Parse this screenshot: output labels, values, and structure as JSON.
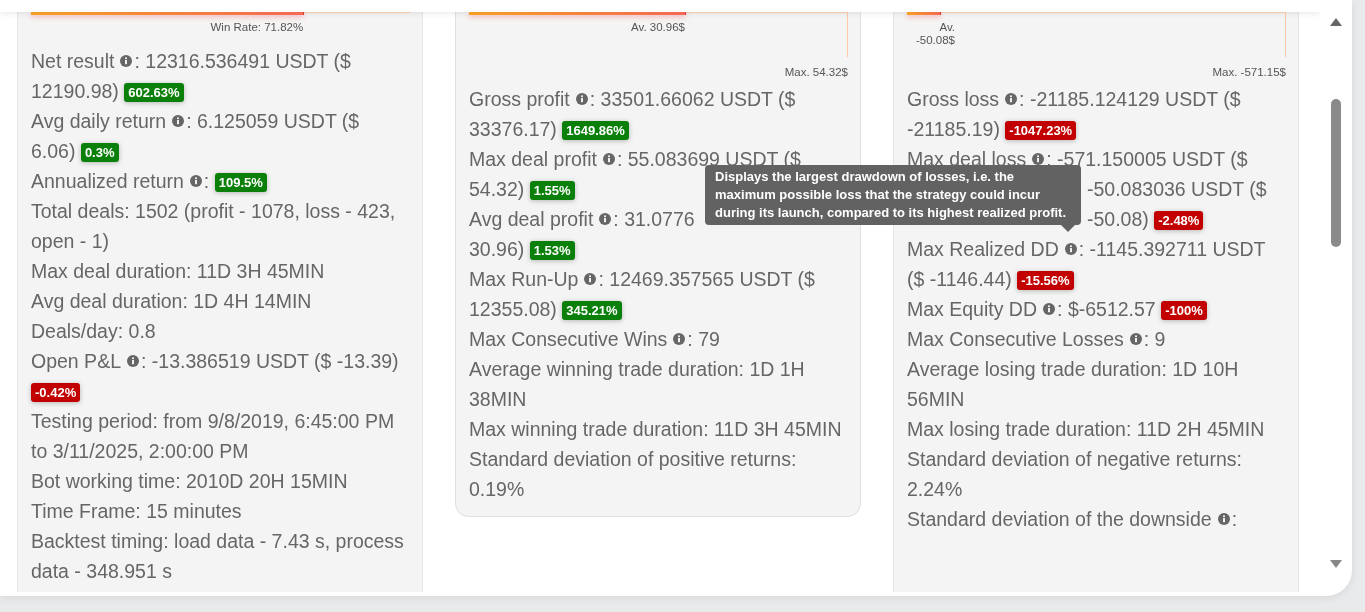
{
  "columns": [
    {
      "chart": {
        "kind": "single",
        "label": "Win Rate: 71.82%",
        "level": 0.7182
      },
      "stats": [
        {
          "label": "Net result",
          "info": true,
          "text": ": 12316.536491 USDT ($",
          "cont": "12190.98)",
          "badge": {
            "text": "602.63%",
            "color": "#0a7f0a"
          }
        },
        {
          "label": "Avg daily return",
          "info": true,
          "text": ": 6.125059 USDT ($",
          "cont": "6.06)",
          "badge": {
            "text": "0.3%",
            "color": "#0a7f0a"
          }
        },
        {
          "label": "Annualized return",
          "info": true,
          "text": ":",
          "badge": {
            "text": "109.5%",
            "color": "#0a7f0a"
          }
        },
        {
          "label": "Total deals: 1502 (profit - 1078, loss - 423, open - 1)",
          "info": false
        },
        {
          "label": "Max deal duration: 11D 3H 45MIN",
          "info": false
        },
        {
          "label": "Avg deal duration: 1D 4H 14MIN",
          "info": false
        },
        {
          "label": "Deals/day: 0.8",
          "info": false
        },
        {
          "label": "Open P&L",
          "info": true,
          "text": ": -13.386519 USDT ($ -13.39)",
          "badge": {
            "text": "-0.42%",
            "color": "#c20000"
          }
        },
        {
          "label": "Testing period: from 9/8/2019, 6:45:00 PM to 3/11/2025, 2:00:00 PM",
          "info": false
        },
        {
          "label": "Bot working time: 2010D 20H 15MIN",
          "info": false
        },
        {
          "label": "Time Frame: 15 minutes",
          "info": false
        },
        {
          "label": "Backtest timing: load data - 7.43 s, process data - 348.951 s",
          "info": false
        }
      ]
    },
    {
      "chart": {
        "kind": "average_max",
        "label": "Av. 30.96$",
        "max_label": "Max. 54.32$",
        "level": 0.57
      },
      "stats": [
        {
          "label": "Gross profit",
          "info": true,
          "text": ": 33501.66062 USDT ($",
          "cont": "33376.17)",
          "badge": {
            "text": "1649.86%",
            "color": "#0a7f0a"
          }
        },
        {
          "label": "Max deal profit",
          "info": true,
          "text": ": 55.083699 USDT ($",
          "cont": "54.32)",
          "badge": {
            "text": "1.55%",
            "color": "#0a7f0a"
          }
        },
        {
          "label": "Avg deal profit",
          "info": true,
          "text": ": 31.0776",
          "cont": "30.96)",
          "badge": {
            "text": "1.53%",
            "color": "#0a7f0a"
          }
        },
        {
          "label": "Max Run-Up",
          "info": true,
          "text": ": 12469.357565 USDT ($",
          "cont": "12355.08)",
          "badge": {
            "text": "345.21%",
            "color": "#0a7f0a"
          }
        },
        {
          "label": "Max Consecutive Wins",
          "info": true,
          "text": ": 79"
        },
        {
          "label": "Average winning trade duration: 1D 1H 38MIN",
          "info": false
        },
        {
          "label": "Max winning trade duration: 11D 3H 45MIN",
          "info": false
        },
        {
          "label": "Standard deviation of positive returns: 0.19%",
          "info": false
        }
      ]
    },
    {
      "chart": {
        "kind": "average_max",
        "label": "Av. -50.08$",
        "max_label": "Max. -571.15$",
        "level": 0.0877
      },
      "stats": [
        {
          "label": "Gross loss",
          "info": true,
          "text": ": -21185.124129 USDT ($",
          "cont": "-21185.19)",
          "badge": {
            "text": "-1047.23%",
            "color": "#c20000"
          }
        },
        {
          "label": "Max deal loss",
          "info": true,
          "text": ": -571.150005 USDT ($"
        },
        {
          "text": "-50.083036 USDT ($",
          "cont": "-50.08)",
          "badge": {
            "text": "-2.48%",
            "color": "#c20000"
          }
        },
        {
          "label": "Max Realized DD",
          "info": true,
          "text": ": -1145.392711 USDT",
          "cont": "($ -1146.44)",
          "badge": {
            "text": "-15.56%",
            "color": "#c20000"
          }
        },
        {
          "label": "Max Equity DD",
          "info": true,
          "text": ": $-6512.57",
          "badge": {
            "text": "-100%",
            "color": "#c20000"
          }
        },
        {
          "label": "Max Consecutive Losses",
          "info": true,
          "text": ": 9"
        },
        {
          "label": "Average losing trade duration: 1D 10H 56MIN",
          "info": false
        },
        {
          "label": "Max losing trade duration: 11D 2H 45MIN",
          "info": false
        },
        {
          "label": "Standard deviation of negative returns: 2.24%",
          "info": false
        },
        {
          "label": "Standard deviation of the downside",
          "info": true,
          "text": ":"
        }
      ]
    }
  ],
  "tooltip": {
    "text": "Displays the largest drawdown of losses, i.e. the maximum possible loss that the strategy could incur during its launch, compared to its highest realized profit."
  }
}
